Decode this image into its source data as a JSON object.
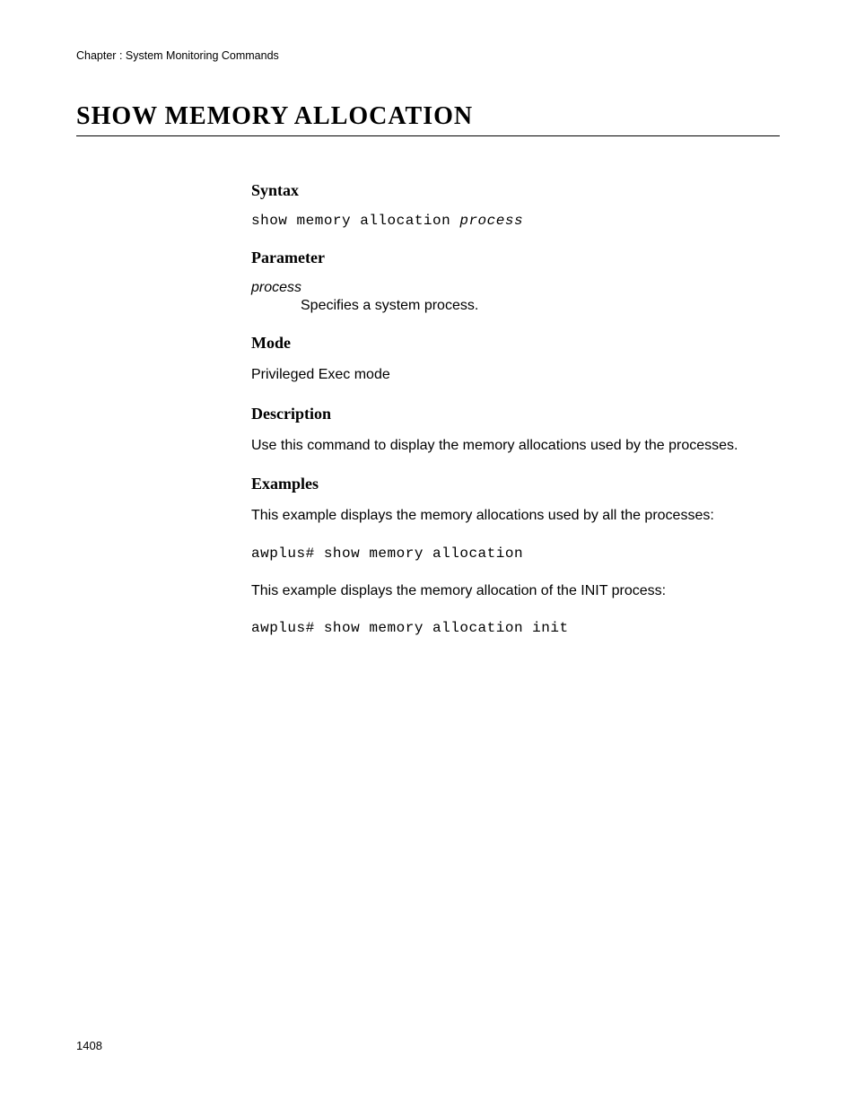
{
  "header": {
    "chapter": "Chapter : System Monitoring Commands"
  },
  "title": "SHOW MEMORY ALLOCATION",
  "sections": {
    "syntax": {
      "heading": "Syntax",
      "command_prefix": "show memory allocation ",
      "command_arg": "process"
    },
    "parameter": {
      "heading": "Parameter",
      "term": "process",
      "description": "Specifies a system process."
    },
    "mode": {
      "heading": "Mode",
      "text": "Privileged Exec mode"
    },
    "description": {
      "heading": "Description",
      "text": "Use this command to display the memory allocations used by the processes."
    },
    "examples": {
      "heading": "Examples",
      "intro1": "This example displays the memory allocations used by all the processes:",
      "cmd1": "awplus# show memory allocation",
      "intro2": "This example displays the memory allocation of the INIT process:",
      "cmd2": "awplus# show memory allocation init"
    }
  },
  "footer": {
    "page_number": "1408"
  }
}
